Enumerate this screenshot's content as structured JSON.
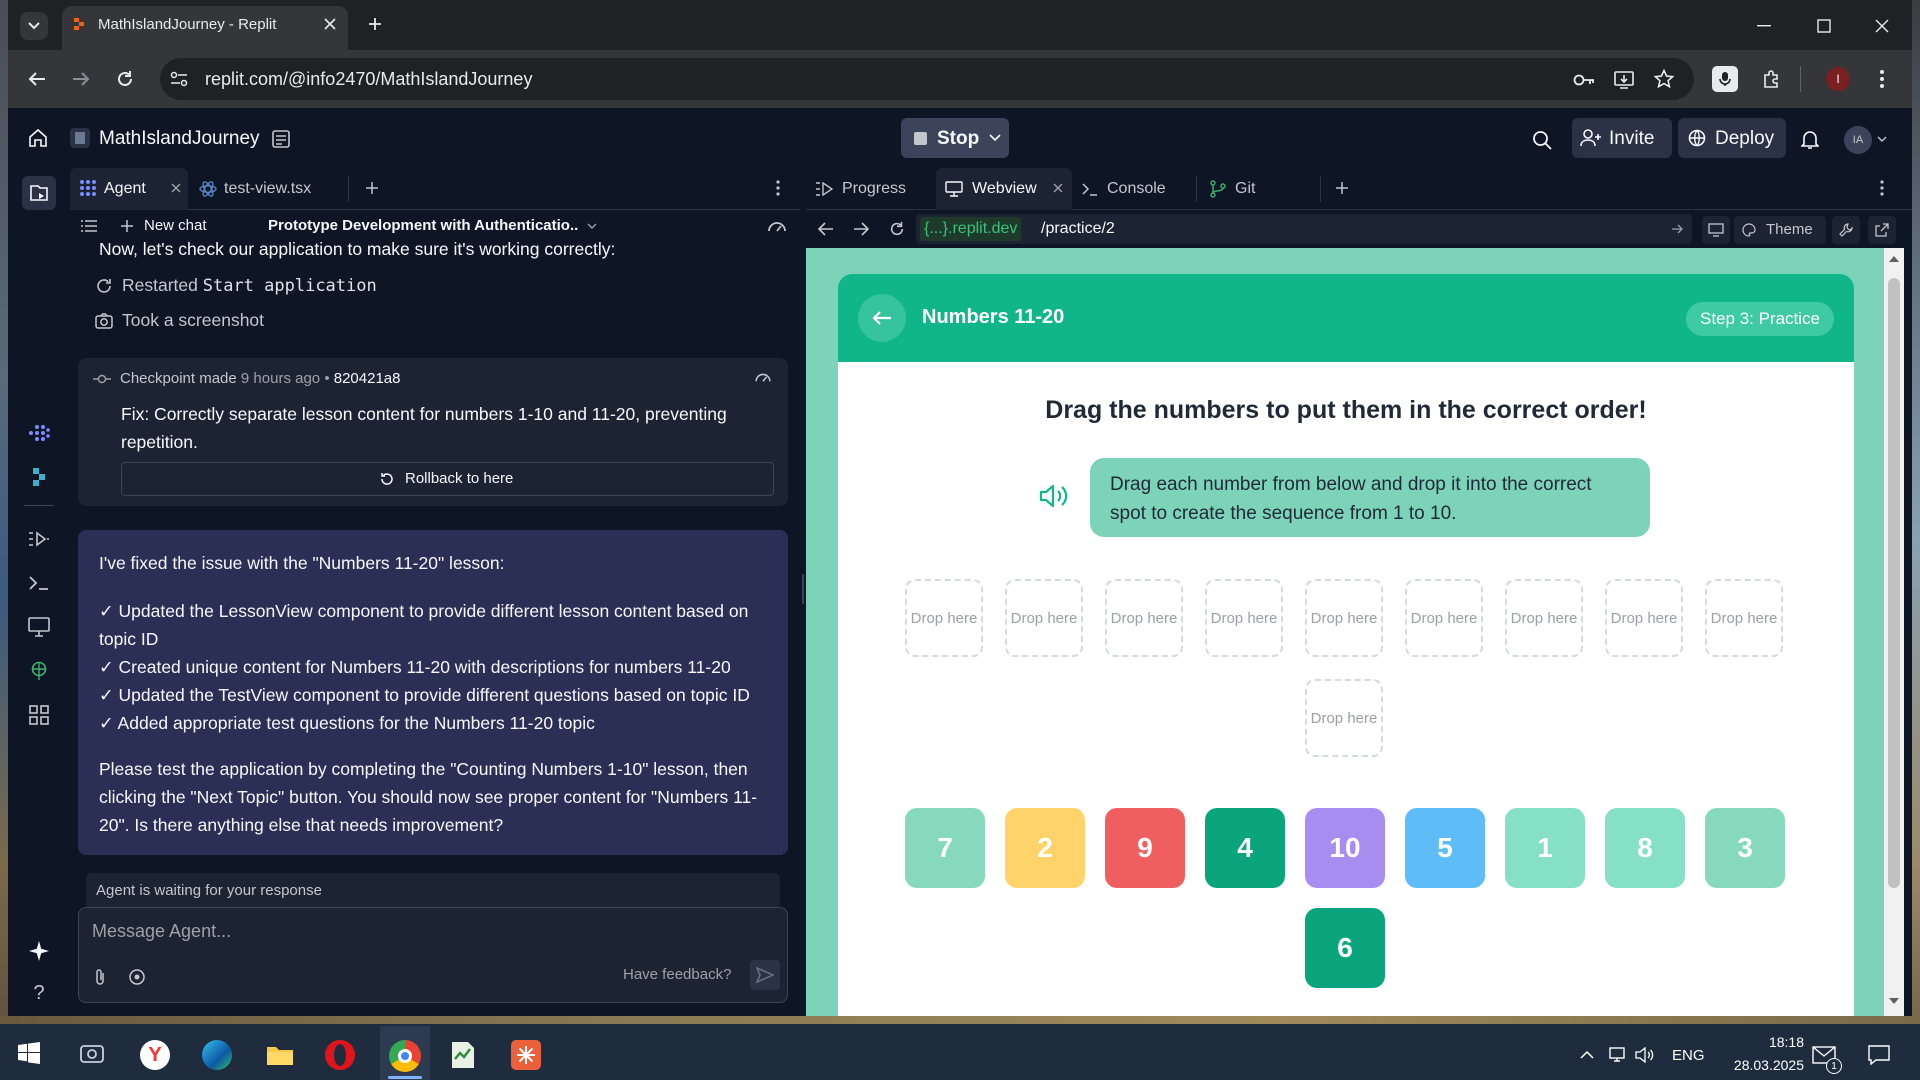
{
  "browser": {
    "tab_title": "MathIslandJourney - Replit",
    "url": "replit.com/@info2470/MathIslandJourney"
  },
  "replit": {
    "project_name": "MathIslandJourney",
    "stop_label": "Stop",
    "invite_label": "Invite",
    "deploy_label": "Deploy",
    "avatar_initials": "IA"
  },
  "left_tabs": [
    {
      "label": "Agent"
    },
    {
      "label": "test-view.tsx"
    }
  ],
  "agent": {
    "new_chat_label": "New chat",
    "chat_title": "Prototype Development with Authenticatio...",
    "intro_line": "Now, let's check our application to make sure it's working correctly:",
    "action1_prefix": "Restarted ",
    "action1_code": "Start application",
    "action2": "Took a screenshot",
    "checkpoint_label": "Checkpoint made",
    "checkpoint_time": "9 hours ago",
    "checkpoint_sep": "•",
    "checkpoint_hash": "820421a8",
    "checkpoint_message": "Fix: Correctly separate lesson content for numbers 1-10 and 11-20, preventing repetition.",
    "rollback_label": "Rollback to here",
    "msg_intro": "I've fixed the issue with the \"Numbers 11-20\" lesson:",
    "msg_items": [
      "✓ Updated the LessonView component to provide different lesson content based on topic ID",
      "✓ Created unique content for Numbers 11-20 with descriptions for numbers 11-20",
      "✓ Updated the TestView component to provide different questions based on topic ID",
      "✓ Added appropriate test questions for the Numbers 11-20 topic"
    ],
    "msg_outro": "Please test the application by completing the \"Counting Numbers 1-10\" lesson, then clicking the \"Next Topic\" button. You should now see proper content for \"Numbers 11-20\". Is there anything else that needs improvement?",
    "waiting_label": "Agent is waiting for your response",
    "input_placeholder": "Message Agent...",
    "feedback_label": "Have feedback?"
  },
  "right_tabs": [
    {
      "label": "Progress"
    },
    {
      "label": "Webview"
    },
    {
      "label": "Console"
    },
    {
      "label": "Git"
    }
  ],
  "webview_bar": {
    "domain": "{...}.replit.dev",
    "path": "/practice/2",
    "theme_label": "Theme"
  },
  "app": {
    "header_title": "Numbers 11-20",
    "step_badge": "Step 3: Practice",
    "heading": "Drag the numbers to put them in the correct order!",
    "instruction": "Drag each number from below and drop it into the correct spot to create the sequence from 1 to 10.",
    "drop_label": "Drop here",
    "tiles": [
      {
        "n": "7",
        "color": "#86d9bd"
      },
      {
        "n": "2",
        "color": "#fdd36a"
      },
      {
        "n": "9",
        "color": "#f05f5f"
      },
      {
        "n": "4",
        "color": "#0aa57d"
      },
      {
        "n": "10",
        "color": "#a98cf0"
      },
      {
        "n": "5",
        "color": "#5ebcf7"
      },
      {
        "n": "1",
        "color": "#86e0c6"
      },
      {
        "n": "8",
        "color": "#86e0c6"
      },
      {
        "n": "3",
        "color": "#86d9bd"
      },
      {
        "n": "6",
        "color": "#0aa57d"
      }
    ]
  },
  "taskbar": {
    "lang": "ENG",
    "time": "18:18",
    "date": "28.03.2025",
    "notif_count": "1"
  }
}
